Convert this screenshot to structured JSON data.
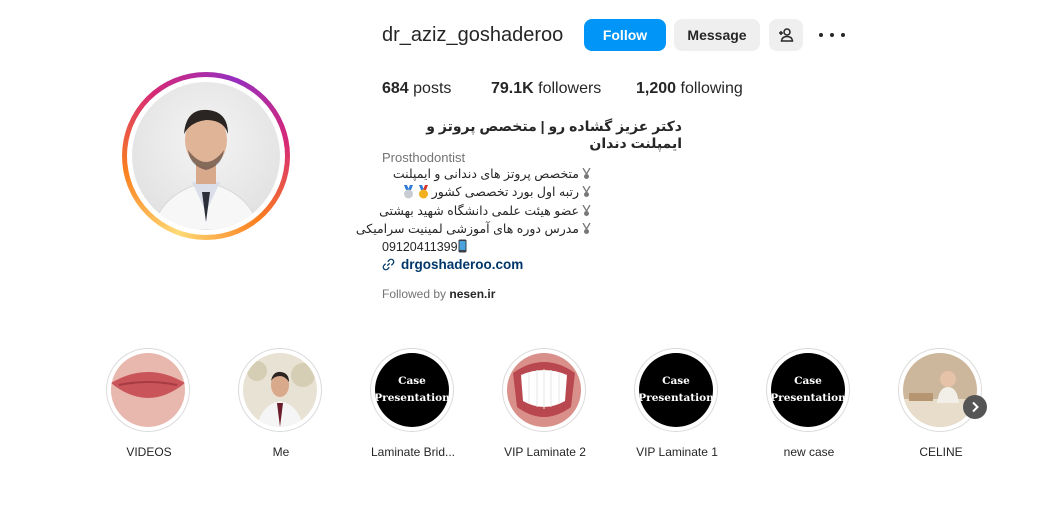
{
  "profile": {
    "username": "dr_aziz_goshaderoo",
    "follow_label": "Follow",
    "message_label": "Message",
    "stats": {
      "posts": "684",
      "posts_label": "posts",
      "followers": "79.1K",
      "followers_label": "followers",
      "following": "1,200",
      "following_label": "following"
    },
    "full_name": "دکتر عزیز گشاده رو | متخصص پروتز و ایمپلنت دندان",
    "category": "Prosthodontist",
    "bio_lines": [
      "متخصص پروتز های دندانی و ایمپلنت",
      "رتبه اول بورد تخصصی کشور",
      "عضو هیئت علمی دانشگاه شهید بهشتی",
      "مدرس دوره های آموزشی لمینیت سرامیکی",
      "09120411399"
    ],
    "link": "drgoshaderoo.com",
    "followed_by_prefix": "Followed by ",
    "followed_by_user": "nesen.ir"
  },
  "highlights": [
    {
      "label": "VIDEOS",
      "kind": "lips"
    },
    {
      "label": "Me",
      "kind": "person"
    },
    {
      "label": "Laminate Brid...",
      "kind": "case",
      "text1": "Case",
      "text2": "Presentation"
    },
    {
      "label": "VIP Laminate 2",
      "kind": "teeth"
    },
    {
      "label": "VIP Laminate 1",
      "kind": "case",
      "text1": "Case",
      "text2": "Presentation"
    },
    {
      "label": "new case",
      "kind": "case",
      "text1": "Case",
      "text2": "Presentation"
    },
    {
      "label": "CELINE",
      "kind": "baby"
    }
  ],
  "colors": {
    "accent": "#0095f6",
    "link": "#00376b",
    "muted": "#737373"
  },
  "icons": [
    "add-user-icon",
    "more-icon",
    "link-icon",
    "medal-icon",
    "chevron-right-icon"
  ]
}
